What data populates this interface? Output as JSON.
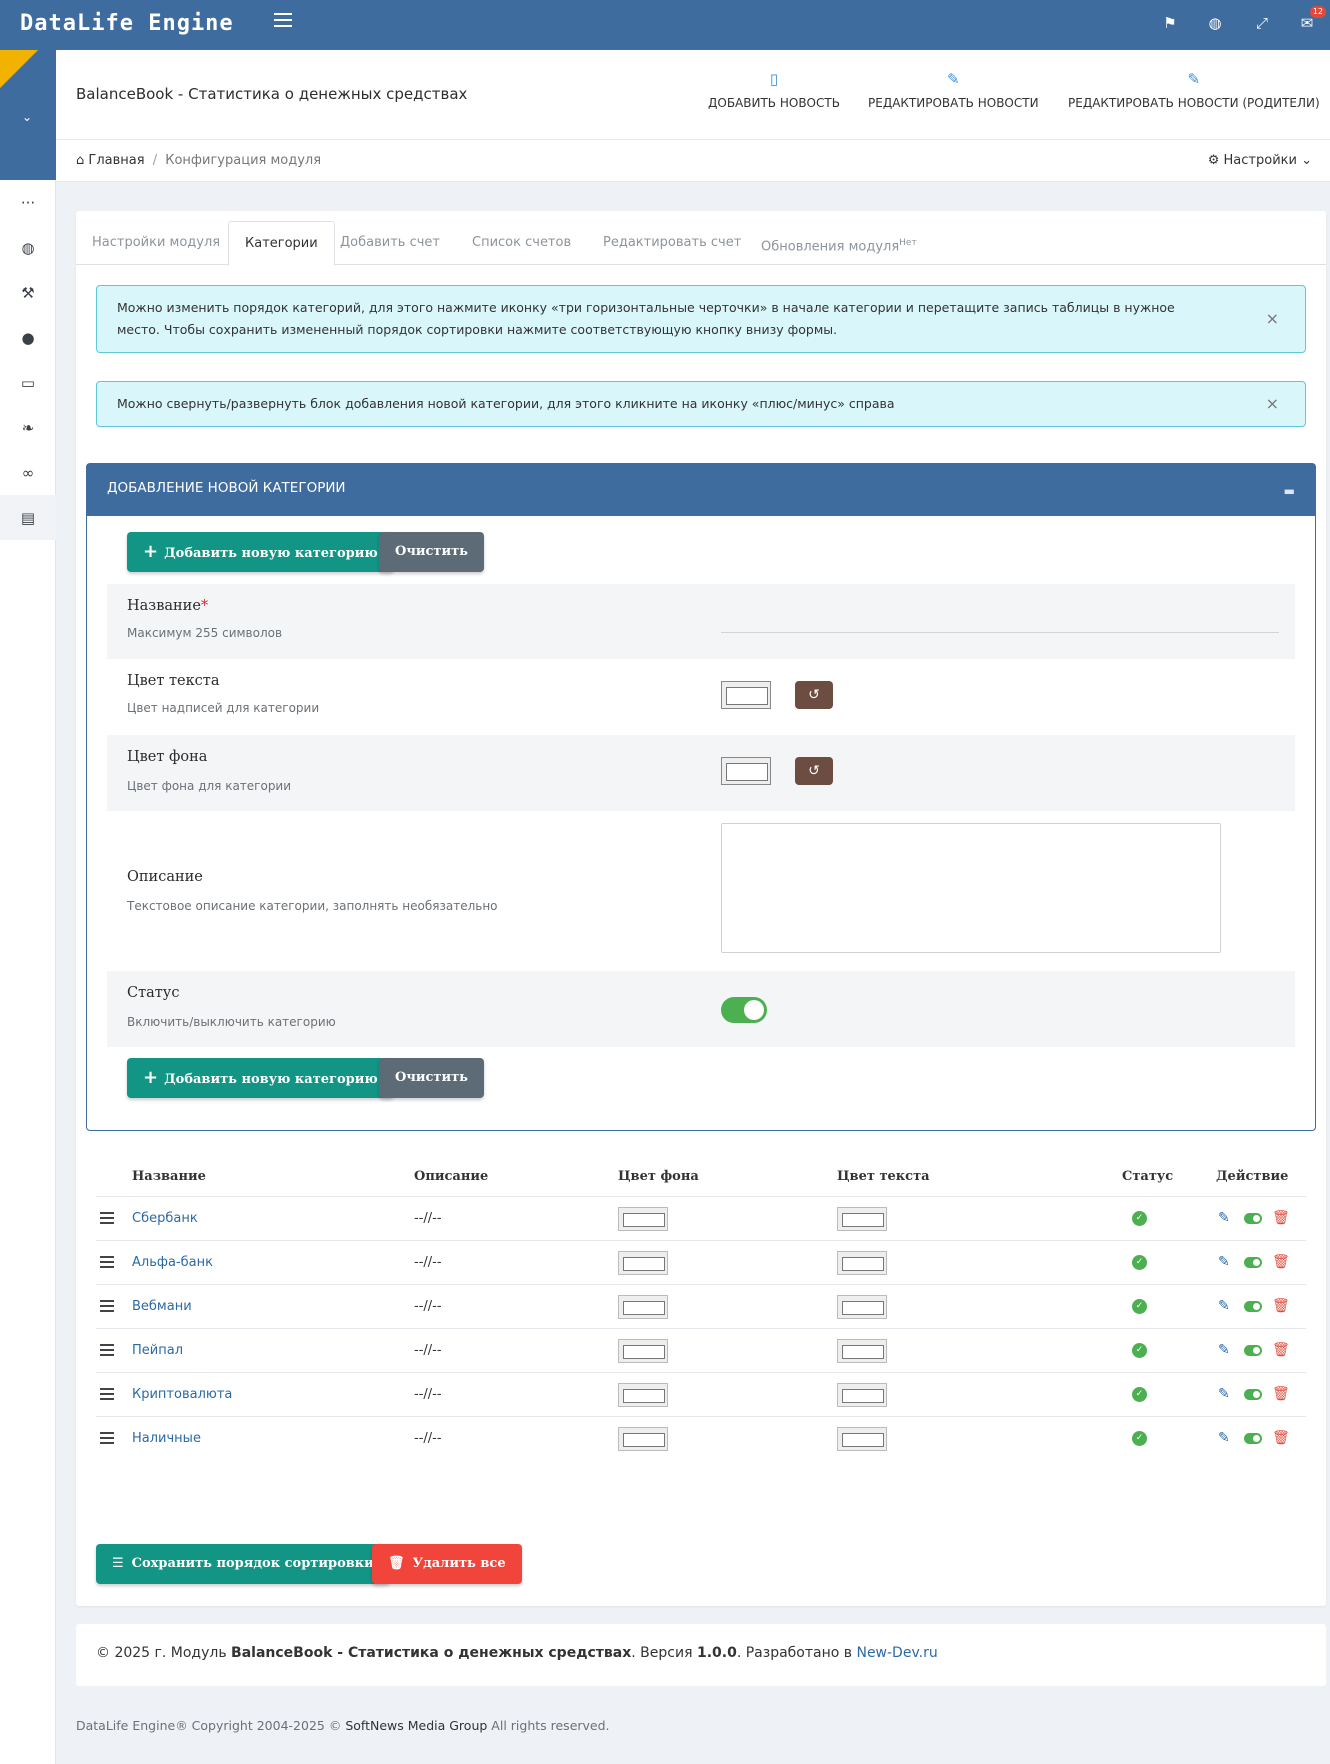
{
  "app": {
    "brand": "DataLife Engine",
    "badge_count": "12"
  },
  "header": {
    "title": "BalanceBook - Статистика о денежных средствах",
    "buttons": [
      {
        "label": "ДОБАВИТЬ НОВОСТЬ",
        "icon": "file-icon"
      },
      {
        "label": "РЕДАКТИРОВАТЬ НОВОСТИ",
        "icon": "edit-icon"
      },
      {
        "label": "РЕДАКТИРОВАТЬ НОВОСТИ (РОДИТЕЛИ)",
        "icon": "edit-icon"
      }
    ]
  },
  "breadcrumbs": {
    "home": "Главная",
    "current": "Конфигурация модуля",
    "settings": "Настройки"
  },
  "tabs": [
    {
      "label": "Настройки модуля"
    },
    {
      "label": "Категории"
    },
    {
      "label": "Добавить счет"
    },
    {
      "label": "Список счетов"
    },
    {
      "label": "Редактировать счет"
    },
    {
      "label": "Обновления модуля",
      "sup": "Нет"
    }
  ],
  "alerts": [
    "Можно изменить порядок категорий, для этого нажмите иконку «три горизонтальные черточки» в начале категории и перетащите запись таблицы в нужное место. Чтобы сохранить измененный порядок сортировки нажмите соответствующую кнопку внизу формы.",
    "Можно свернуть/развернуть блок добавления новой категории, для этого кликните на иконку «плюс/минус» справа"
  ],
  "form": {
    "heading": "ДОБАВЛЕНИЕ НОВОЙ КАТЕГОРИИ",
    "add_label": "Добавить новую категорию",
    "clear_label": "Очистить",
    "fields": {
      "name": {
        "label": "Название",
        "required": "*",
        "hint": "Максимум 255 символов"
      },
      "text_color": {
        "label": "Цвет текста",
        "hint": "Цвет надписей для категории"
      },
      "bg_color": {
        "label": "Цвет фона",
        "hint": "Цвет фона для категории"
      },
      "description": {
        "label": "Описание",
        "hint": "Текстовое описание категории, заполнять необязательно"
      },
      "status": {
        "label": "Статус",
        "hint": "Включить/выключить категорию"
      }
    }
  },
  "table": {
    "columns": {
      "name": "Название",
      "description": "Описание",
      "bg": "Цвет фона",
      "text": "Цвет текста",
      "status": "Статус",
      "action": "Действие"
    },
    "rows": [
      {
        "name": "Сбербанк",
        "description": "--//--"
      },
      {
        "name": "Альфа-банк",
        "description": "--//--"
      },
      {
        "name": "Вебмани",
        "description": "--//--"
      },
      {
        "name": "Пейпал",
        "description": "--//--"
      },
      {
        "name": "Криптовалюта",
        "description": "--//--"
      },
      {
        "name": "Наличные",
        "description": "--//--"
      }
    ]
  },
  "bottom_buttons": {
    "save": "Сохранить порядок сортировки",
    "delete_all": "Удалить все"
  },
  "footer": {
    "prefix": "© 2025 г. Модуль ",
    "module": "BalanceBook - Статистика о денежных средствах",
    "version_label": ". Версия ",
    "version": "1.0.0",
    "dev_label": ". Разработано в ",
    "dev": "New-Dev.ru"
  },
  "copyright": {
    "text1": "DataLife Engine® Copyright 2004-2025 ©",
    "company": "SoftNews Media Group",
    "text2": "All rights reserved."
  }
}
